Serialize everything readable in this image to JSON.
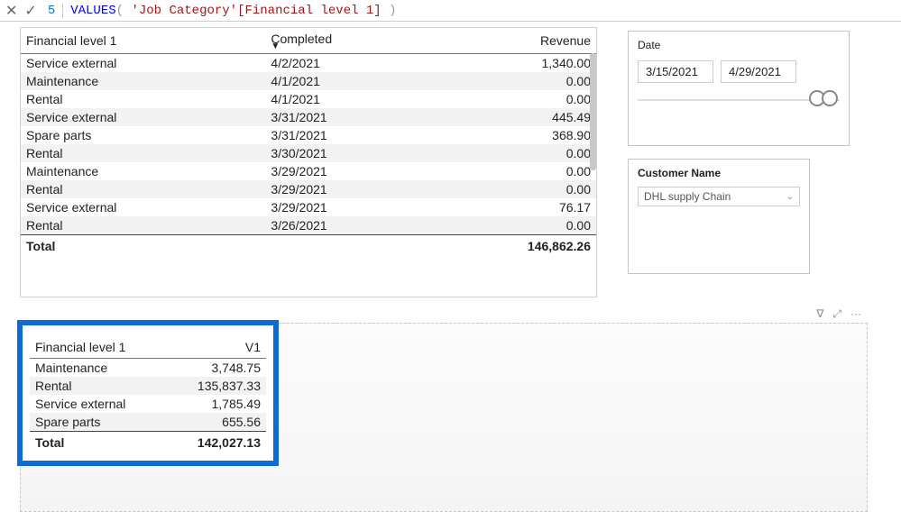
{
  "formula": {
    "line_number": "5",
    "keyword": "VALUES",
    "open": "(",
    "arg": "'Job Category'[Financial level 1]",
    "close": ")"
  },
  "table1": {
    "headers": {
      "fin": "Financial level 1",
      "completed": "Completed",
      "revenue": "Revenue"
    },
    "rows": [
      {
        "fin": "Service external",
        "completed": "4/2/2021",
        "revenue": "1,340.00"
      },
      {
        "fin": "Maintenance",
        "completed": "4/1/2021",
        "revenue": "0.00"
      },
      {
        "fin": "Rental",
        "completed": "4/1/2021",
        "revenue": "0.00"
      },
      {
        "fin": "Service external",
        "completed": "3/31/2021",
        "revenue": "445.49"
      },
      {
        "fin": "Spare parts",
        "completed": "3/31/2021",
        "revenue": "368.90"
      },
      {
        "fin": "Rental",
        "completed": "3/30/2021",
        "revenue": "0.00"
      },
      {
        "fin": "Maintenance",
        "completed": "3/29/2021",
        "revenue": "0.00"
      },
      {
        "fin": "Rental",
        "completed": "3/29/2021",
        "revenue": "0.00"
      },
      {
        "fin": "Service external",
        "completed": "3/29/2021",
        "revenue": "76.17"
      },
      {
        "fin": "Rental",
        "completed": "3/26/2021",
        "revenue": "0.00"
      }
    ],
    "total_label": "Total",
    "total_value": "146,862.26"
  },
  "date_slicer": {
    "title": "Date",
    "start": "3/15/2021",
    "end": "4/29/2021"
  },
  "cust_slicer": {
    "title": "Customer Name",
    "selected": "DHL supply Chain"
  },
  "table2": {
    "headers": {
      "fin": "Financial level 1",
      "v1": "V1"
    },
    "rows": [
      {
        "fin": "Maintenance",
        "v1": "3,748.75"
      },
      {
        "fin": "Rental",
        "v1": "135,837.33"
      },
      {
        "fin": "Service external",
        "v1": "1,785.49"
      },
      {
        "fin": "Spare parts",
        "v1": "655.56"
      }
    ],
    "total_label": "Total",
    "total_value": "142,027.13"
  },
  "icons": {
    "filter": "⧩",
    "focus": "⤢",
    "more": "···"
  }
}
